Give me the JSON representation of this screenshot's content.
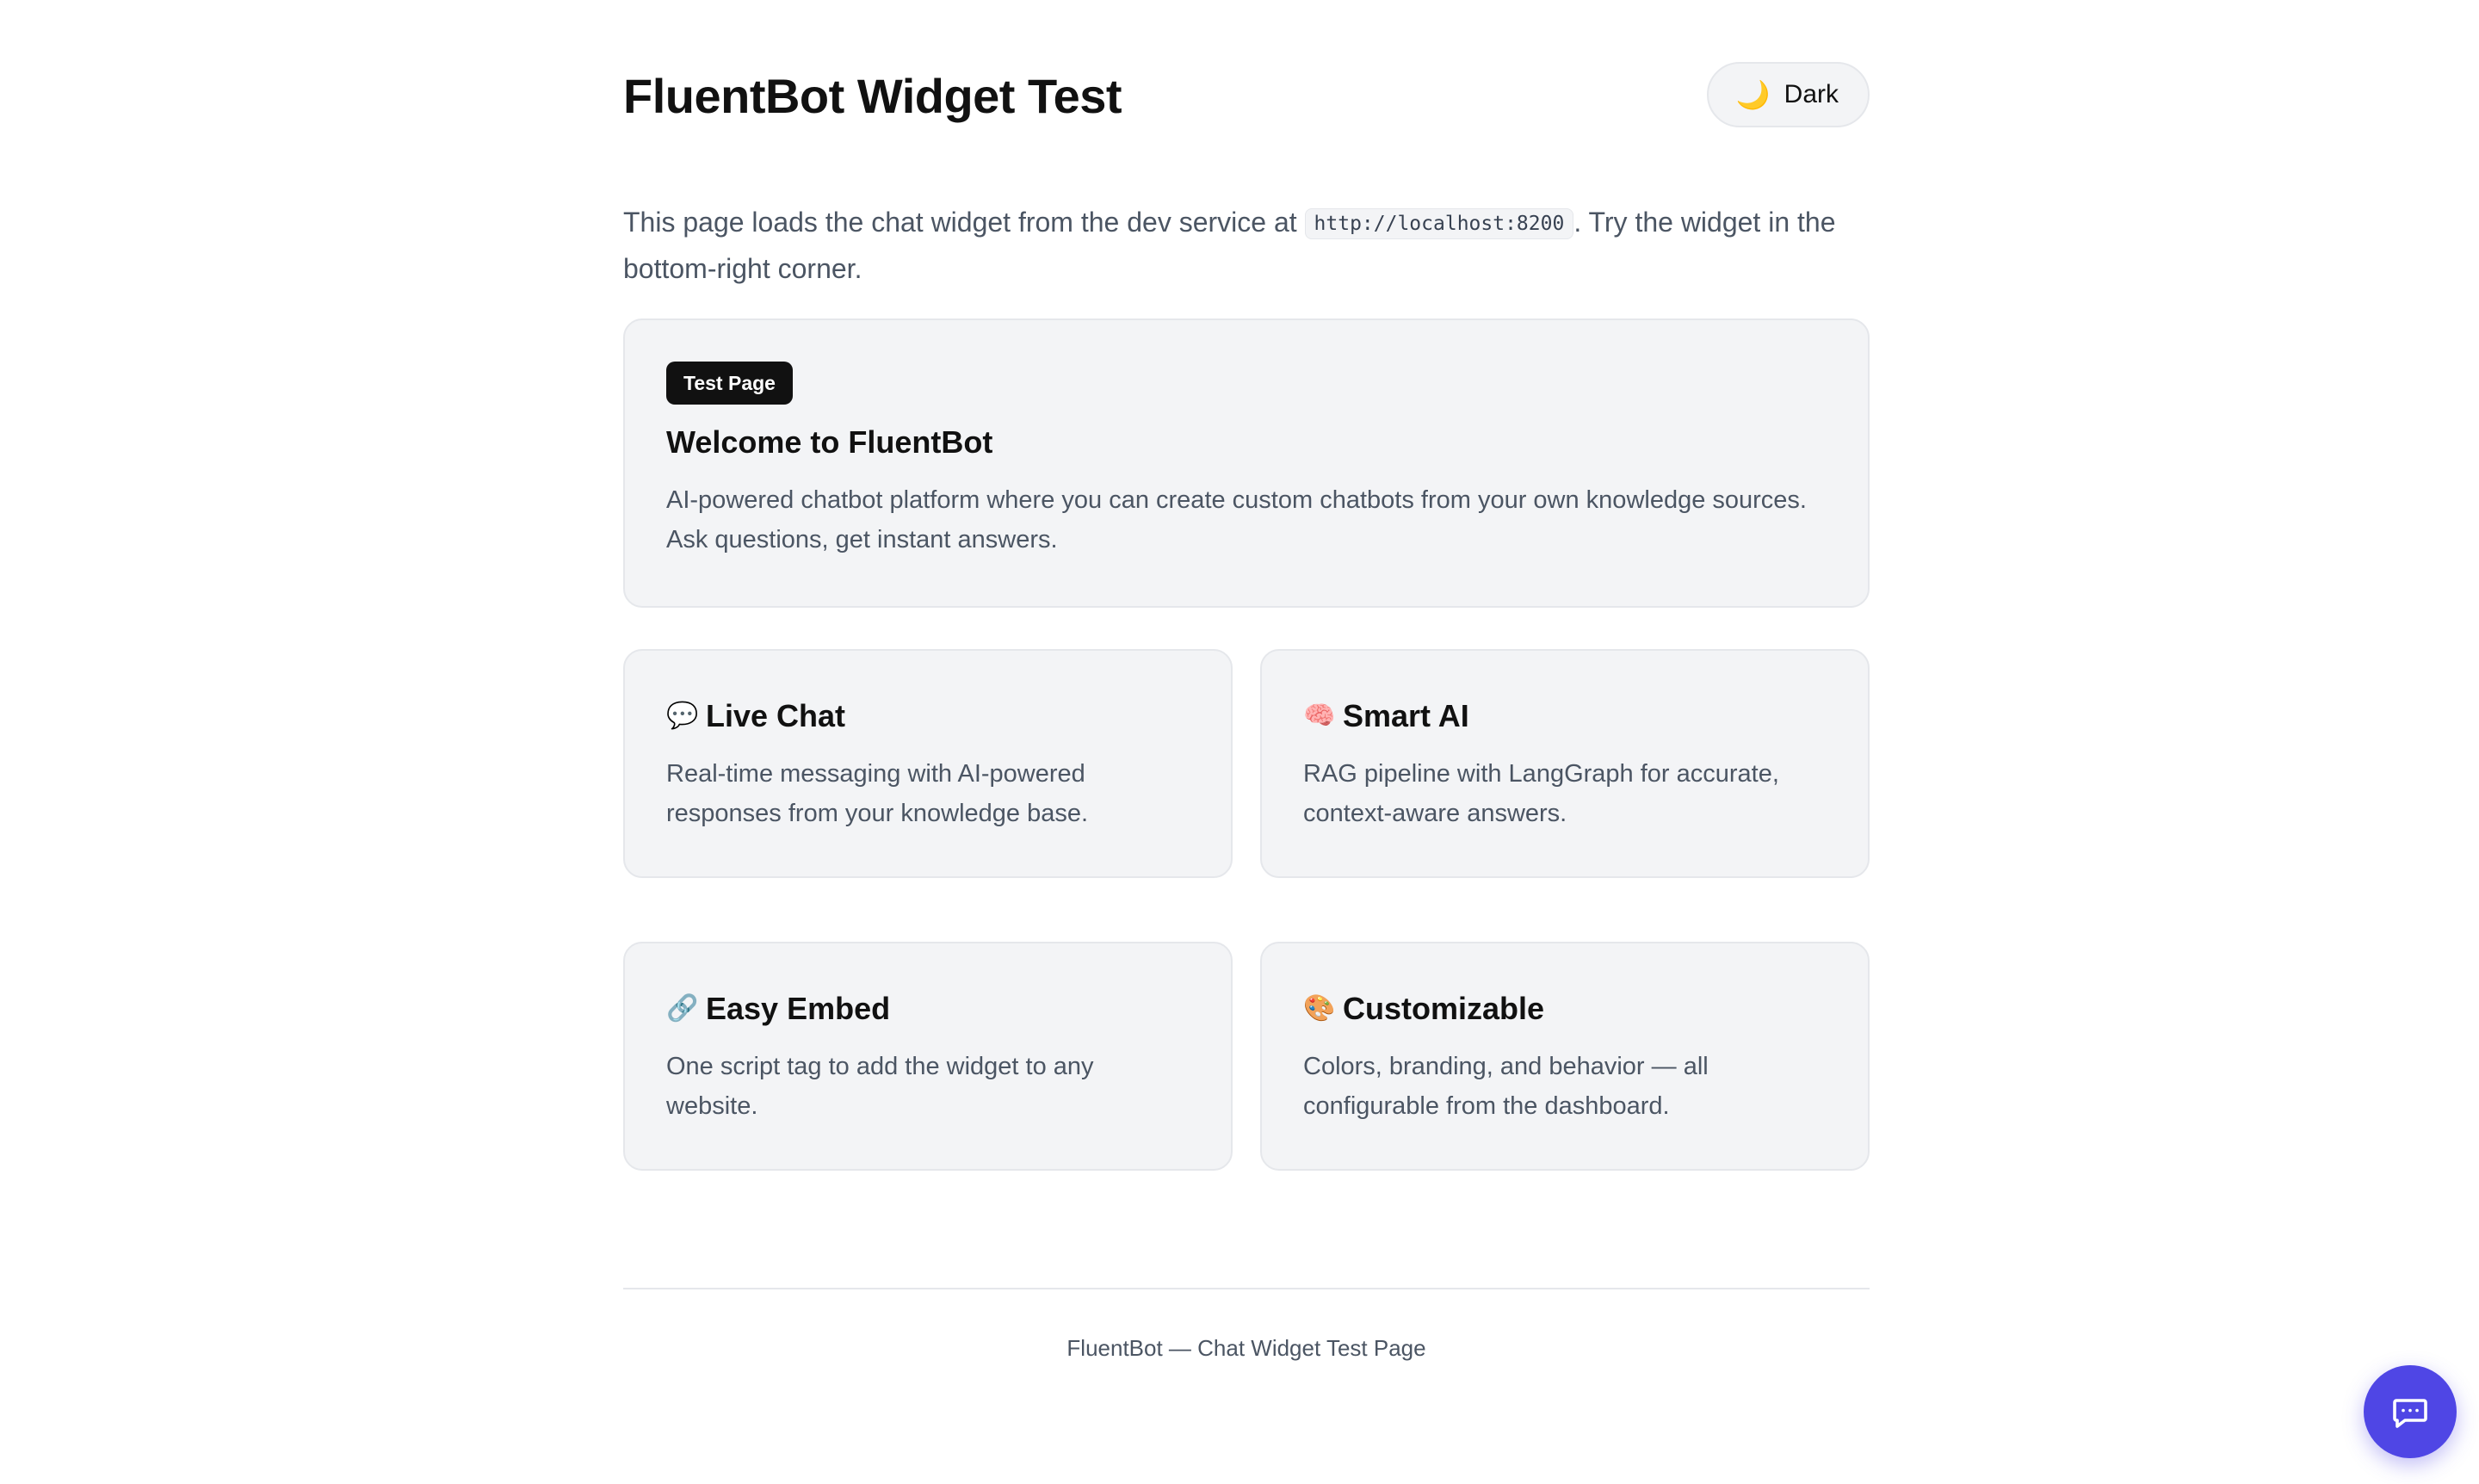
{
  "header": {
    "title": "FluentBot Widget Test",
    "theme_toggle": {
      "icon": "moon-icon",
      "glyph": "🌙",
      "label": "Dark"
    }
  },
  "intro": {
    "text_before": "This page loads the chat widget from the dev service at ",
    "code": "http://localhost:8200",
    "text_after": ". Try the widget in the bottom-right corner."
  },
  "hero": {
    "badge": "Test Page",
    "heading": "Welcome to FluentBot",
    "description": "AI-powered chatbot platform where you can create custom chatbots from your own knowledge sources. Ask questions, get instant answers."
  },
  "features": [
    {
      "icon": "speech-bubble-icon",
      "glyph": "💬",
      "title": "Live Chat",
      "description": "Real-time messaging with AI-powered responses from your knowledge base."
    },
    {
      "icon": "brain-icon",
      "glyph": "🧠",
      "title": "Smart AI",
      "description": "RAG pipeline with LangGraph for accurate, context-aware answers."
    },
    {
      "icon": "link-icon",
      "glyph": "🔗",
      "title": "Easy Embed",
      "description": "One script tag to add the widget to any website."
    },
    {
      "icon": "palette-icon",
      "glyph": "🎨",
      "title": "Customizable",
      "description": "Colors, branding, and behavior — all configurable from the dashboard."
    }
  ],
  "footer": {
    "text": "FluentBot — Chat Widget Test Page"
  },
  "chat_widget": {
    "icon": "chat-icon",
    "color": "#4f46e5"
  },
  "colors": {
    "accent": "#4f46e5",
    "card_bg": "#f3f4f6",
    "badge_bg": "#111111"
  }
}
